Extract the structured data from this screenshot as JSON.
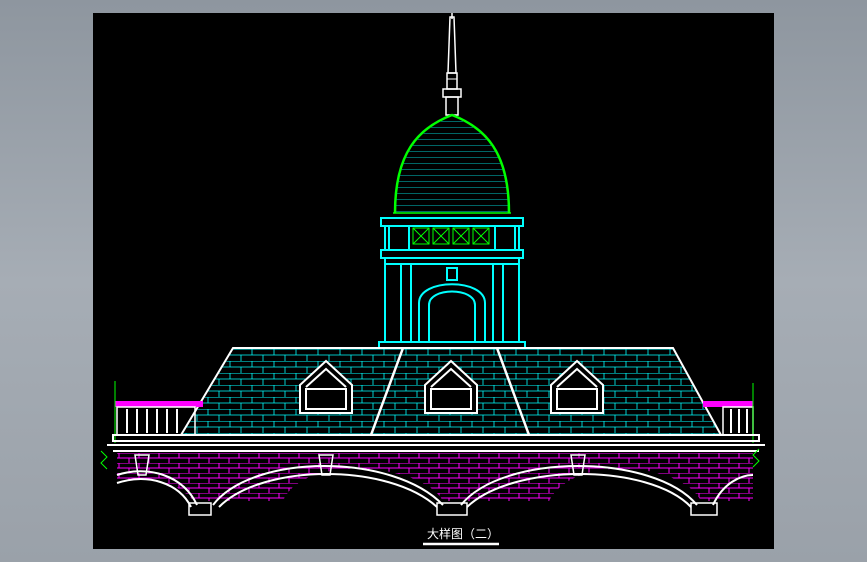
{
  "drawing": {
    "title": "大样图（二）",
    "colors": {
      "background": "#000000",
      "outline": "#ffffff",
      "tower": "#00ffff",
      "dome": "#00ff00",
      "roof_tiles": "#00ffff",
      "wall_brick": "#ff00ff",
      "accent": "#ff00ff",
      "grid_marks": "#00ff00"
    }
  }
}
